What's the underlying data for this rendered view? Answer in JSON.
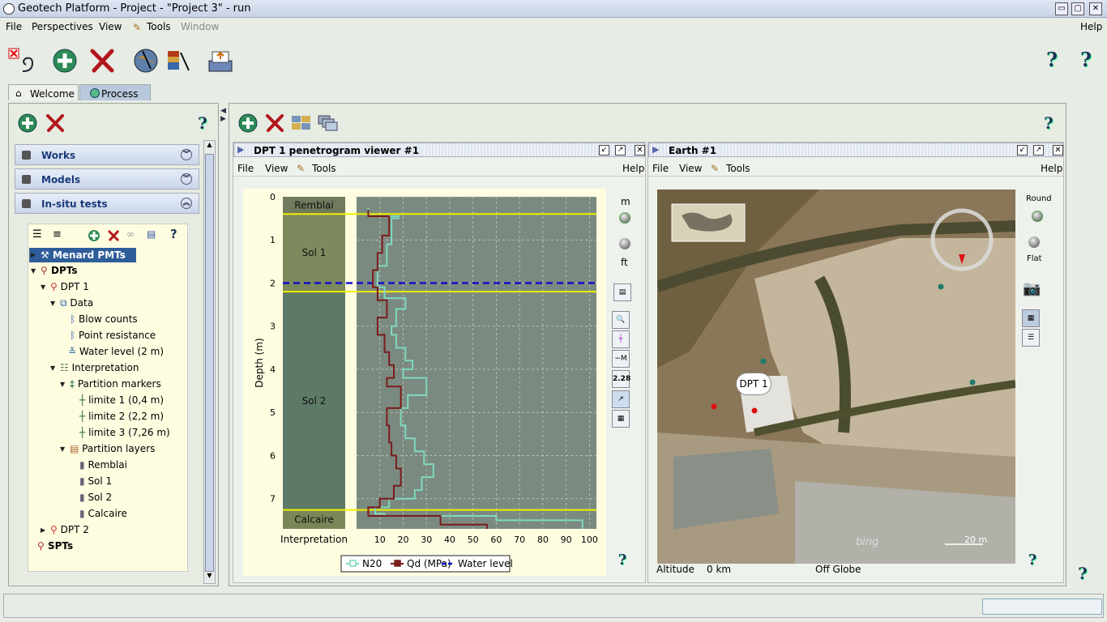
{
  "window": {
    "title": "Geotech Platform - Project - \"Project 3\" - run"
  },
  "menubar": {
    "file": "File",
    "perspectives": "Perspectives",
    "view": "View",
    "tools": "Tools",
    "window": "Window",
    "help": "Help"
  },
  "tabs": {
    "welcome": "Welcome",
    "process": "Process"
  },
  "accordion": {
    "works": "Works",
    "models": "Models",
    "insitu": "In-situ tests"
  },
  "tree": {
    "menard": "Menard PMTs",
    "dpts": "DPTs",
    "dpt1": "DPT 1",
    "data": "Data",
    "blow": "Blow counts",
    "point": "Point resistance",
    "water": "Water level (2 m)",
    "interp": "Interpretation",
    "markers": "Partition markers",
    "lim1": "limite 1 (0,4 m)",
    "lim2": "limite 2 (2,2 m)",
    "lim3": "limite 3 (7,26 m)",
    "layers": "Partition layers",
    "remblai": "Remblai",
    "sol1": "Sol 1",
    "sol2": "Sol 2",
    "calcaire": "Calcaire",
    "dpt2": "DPT 2",
    "spts": "SPTs"
  },
  "viewer": {
    "title": "DPT 1 penetrogram viewer #1",
    "menu_file": "File",
    "menu_view": "View",
    "menu_tools": "Tools",
    "menu_help": "Help",
    "unit_m": "m",
    "unit_ft": "ft",
    "val_btn": "2.28",
    "interp_label": "Interpretation"
  },
  "earth": {
    "title": "Earth #1",
    "menu_file": "File",
    "menu_view": "View",
    "menu_tools": "Tools",
    "menu_help": "Help",
    "round": "Round",
    "flat": "Flat",
    "marker": "DPT 1",
    "altitude_label": "Altitude",
    "altitude_value": "0 km",
    "status": "Off Globe",
    "scale": "20 m",
    "bing": "bing"
  },
  "chart_data": {
    "type": "line",
    "ylabel": "Depth (m)",
    "ylim": [
      0,
      7.7
    ],
    "y_ticks": [
      0,
      1,
      2,
      3,
      4,
      5,
      6,
      7
    ],
    "x_ticks": [
      10,
      20,
      30,
      40,
      50,
      60,
      70,
      80,
      90,
      100
    ],
    "xlim": [
      0,
      103
    ],
    "layers": [
      {
        "name": "Remblai",
        "top": 0,
        "bottom": 0.4,
        "color": "#707a5e"
      },
      {
        "name": "Sol 1",
        "top": 0.4,
        "bottom": 2.2,
        "color": "#7d8a5e"
      },
      {
        "name": "Sol 2",
        "top": 2.2,
        "bottom": 7.26,
        "color": "#5d7a68"
      },
      {
        "name": "Calcaire",
        "top": 7.26,
        "bottom": 7.7,
        "color": "#7a8658"
      }
    ],
    "markers": [
      0.4,
      2.2,
      7.26
    ],
    "water_level": 2.0,
    "legend": [
      "N20",
      "Qd (MPa)",
      "Water level"
    ],
    "series": [
      {
        "name": "N20",
        "color": "#7fd8c0",
        "points": [
          [
            5,
            0.25
          ],
          [
            5,
            0.45
          ],
          [
            18,
            0.45
          ],
          [
            18,
            0.5
          ],
          [
            15,
            0.5
          ],
          [
            15,
            1.1
          ],
          [
            13,
            1.1
          ],
          [
            13,
            1.6
          ],
          [
            9,
            1.6
          ],
          [
            9,
            2.1
          ],
          [
            12,
            2.1
          ],
          [
            12,
            2.35
          ],
          [
            21,
            2.35
          ],
          [
            21,
            2.6
          ],
          [
            17,
            2.6
          ],
          [
            17,
            3.0
          ],
          [
            15,
            3.0
          ],
          [
            15,
            3.2
          ],
          [
            17,
            3.2
          ],
          [
            17,
            3.5
          ],
          [
            21,
            3.5
          ],
          [
            21,
            3.8
          ],
          [
            24,
            3.8
          ],
          [
            24,
            4.0
          ],
          [
            20,
            4.0
          ],
          [
            20,
            4.2
          ],
          [
            30,
            4.2
          ],
          [
            30,
            4.6
          ],
          [
            22,
            4.6
          ],
          [
            22,
            4.9
          ],
          [
            19,
            4.9
          ],
          [
            19,
            5.3
          ],
          [
            21,
            5.3
          ],
          [
            21,
            5.6
          ],
          [
            25,
            5.6
          ],
          [
            25,
            5.9
          ],
          [
            29,
            5.9
          ],
          [
            29,
            6.2
          ],
          [
            33,
            6.2
          ],
          [
            33,
            6.5
          ],
          [
            28,
            6.5
          ],
          [
            28,
            6.8
          ],
          [
            25,
            6.8
          ],
          [
            25,
            7.0
          ],
          [
            14,
            7.0
          ],
          [
            14,
            7.2
          ],
          [
            8,
            7.2
          ],
          [
            8,
            7.35
          ],
          [
            12,
            7.35
          ],
          [
            12,
            7.4
          ],
          [
            60,
            7.4
          ],
          [
            60,
            7.5
          ],
          [
            97,
            7.5
          ],
          [
            97,
            7.7
          ]
        ]
      },
      {
        "name": "Qd (MPa)",
        "color": "#7a1c1c",
        "points": [
          [
            5,
            0.3
          ],
          [
            5,
            0.45
          ],
          [
            14,
            0.45
          ],
          [
            14,
            0.9
          ],
          [
            11,
            0.9
          ],
          [
            11,
            1.3
          ],
          [
            9,
            1.3
          ],
          [
            9,
            1.7
          ],
          [
            7,
            1.7
          ],
          [
            7,
            2.1
          ],
          [
            9,
            2.1
          ],
          [
            9,
            2.4
          ],
          [
            13,
            2.4
          ],
          [
            13,
            2.8
          ],
          [
            9,
            2.8
          ],
          [
            9,
            3.2
          ],
          [
            12,
            3.2
          ],
          [
            12,
            3.6
          ],
          [
            14,
            3.6
          ],
          [
            14,
            3.9
          ],
          [
            16,
            3.9
          ],
          [
            16,
            4.2
          ],
          [
            13,
            4.2
          ],
          [
            13,
            4.4
          ],
          [
            19,
            4.4
          ],
          [
            19,
            4.9
          ],
          [
            13,
            4.9
          ],
          [
            13,
            5.3
          ],
          [
            14,
            5.3
          ],
          [
            14,
            5.7
          ],
          [
            15,
            5.7
          ],
          [
            15,
            6.0
          ],
          [
            17,
            6.0
          ],
          [
            17,
            6.3
          ],
          [
            19,
            6.3
          ],
          [
            19,
            6.7
          ],
          [
            16,
            6.7
          ],
          [
            16,
            7.0
          ],
          [
            10,
            7.0
          ],
          [
            10,
            7.2
          ],
          [
            5,
            7.2
          ],
          [
            5,
            7.4
          ],
          [
            36,
            7.4
          ],
          [
            36,
            7.6
          ],
          [
            56,
            7.6
          ],
          [
            56,
            7.7
          ]
        ]
      }
    ]
  }
}
